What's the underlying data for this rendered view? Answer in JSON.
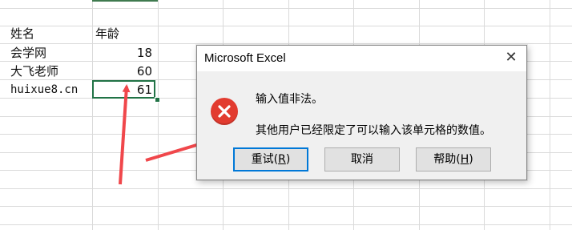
{
  "sheet": {
    "headers": {
      "name": "姓名",
      "age": "年龄"
    },
    "rows": [
      {
        "name": "会学网",
        "age": "18"
      },
      {
        "name": "大飞老师",
        "age": "60"
      },
      {
        "name": "huixue8.cn",
        "age": "61"
      }
    ],
    "active_cell_value": "61"
  },
  "dialog": {
    "title": "Microsoft Excel",
    "close_glyph": "✕",
    "icon": "error-x-icon",
    "message_line1": "输入值非法。",
    "message_line2": "其他用户已经限定了可以输入该单元格的数值。",
    "buttons": {
      "retry_label": "重试",
      "retry_key": "R",
      "cancel_label": "取消",
      "help_label": "帮助",
      "help_key": "H"
    }
  },
  "colors": {
    "error_red": "#e23b2f",
    "annotation_arrow": "#f0474b",
    "excel_green": "#217346"
  }
}
